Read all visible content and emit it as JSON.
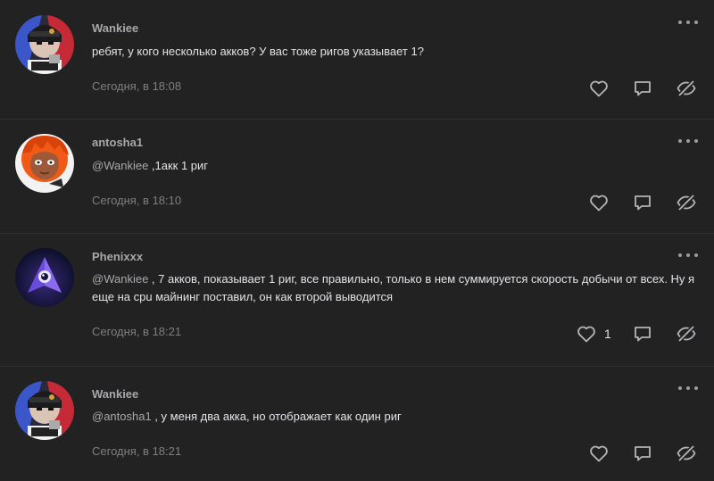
{
  "comments": [
    {
      "author": "Wankiee",
      "mention": "",
      "text": "ребят, у кого несколько акков? У вас тоже ригов указывает 1?",
      "time": "Сегодня, в 18:08",
      "likes": "",
      "avatar": "avatar-wankiee"
    },
    {
      "author": "antosha1",
      "mention": "@Wankiee",
      "text": " ,1акк 1 риг",
      "time": "Сегодня, в 18:10",
      "likes": "",
      "avatar": "avatar-antosha1"
    },
    {
      "author": "Phenixxx",
      "mention": "@Wankiee",
      "text": " , 7 акков, показывает 1 риг, все правильно, только в нем суммируется скорость добычи от всех. Ну я еще на cpu майнинг поставил, он как второй выводится",
      "time": "Сегодня, в 18:21",
      "likes": "1",
      "avatar": "avatar-phenixxx"
    },
    {
      "author": "Wankiee",
      "mention": "@antosha1",
      "text": " , у меня два акка, но отображает как один риг",
      "time": "Сегодня, в 18:21",
      "likes": "",
      "avatar": "avatar-wankiee"
    }
  ],
  "icons": {
    "like": "heart-icon",
    "reply": "comment-bubble-icon",
    "hide": "eye-slash-icon",
    "menu": "more-dots-icon"
  },
  "colors": {
    "background": "#222222",
    "text": "#e1e3e6",
    "muted": "#a6a8ab",
    "time": "#7d7f82",
    "divider": "#2f2f2f"
  }
}
